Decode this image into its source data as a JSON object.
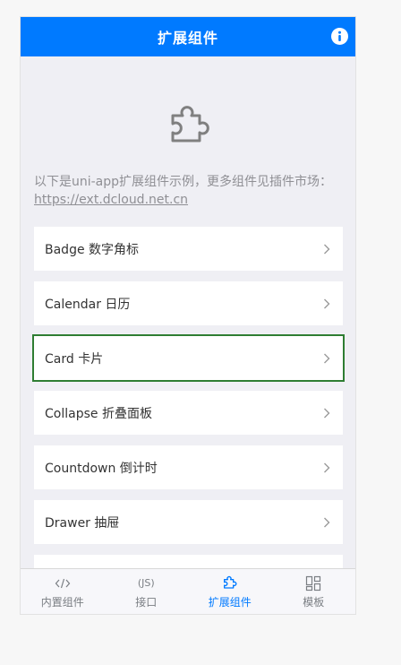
{
  "navbar": {
    "title": "扩展组件"
  },
  "intro": {
    "text": "以下是uni-app扩展组件示例，更多组件见插件市场：",
    "link": "https://ext.dcloud.net.cn"
  },
  "list": [
    {
      "label": "Badge 数字角标"
    },
    {
      "label": "Calendar 日历"
    },
    {
      "label": "Card 卡片"
    },
    {
      "label": "Collapse 折叠面板"
    },
    {
      "label": "Countdown 倒计时"
    },
    {
      "label": "Drawer 抽屉"
    }
  ],
  "tabbar": {
    "tabs": [
      {
        "label": "内置组件",
        "icon": "code-icon"
      },
      {
        "label": "接口",
        "icon_text": "(JS)",
        "icon": "js-icon"
      },
      {
        "label": "扩展组件",
        "icon": "puzzle-icon",
        "active": true
      },
      {
        "label": "模板",
        "icon": "grid-icon"
      }
    ]
  },
  "colors": {
    "primary": "#007aff",
    "selected_outline": "#2e7d32"
  }
}
